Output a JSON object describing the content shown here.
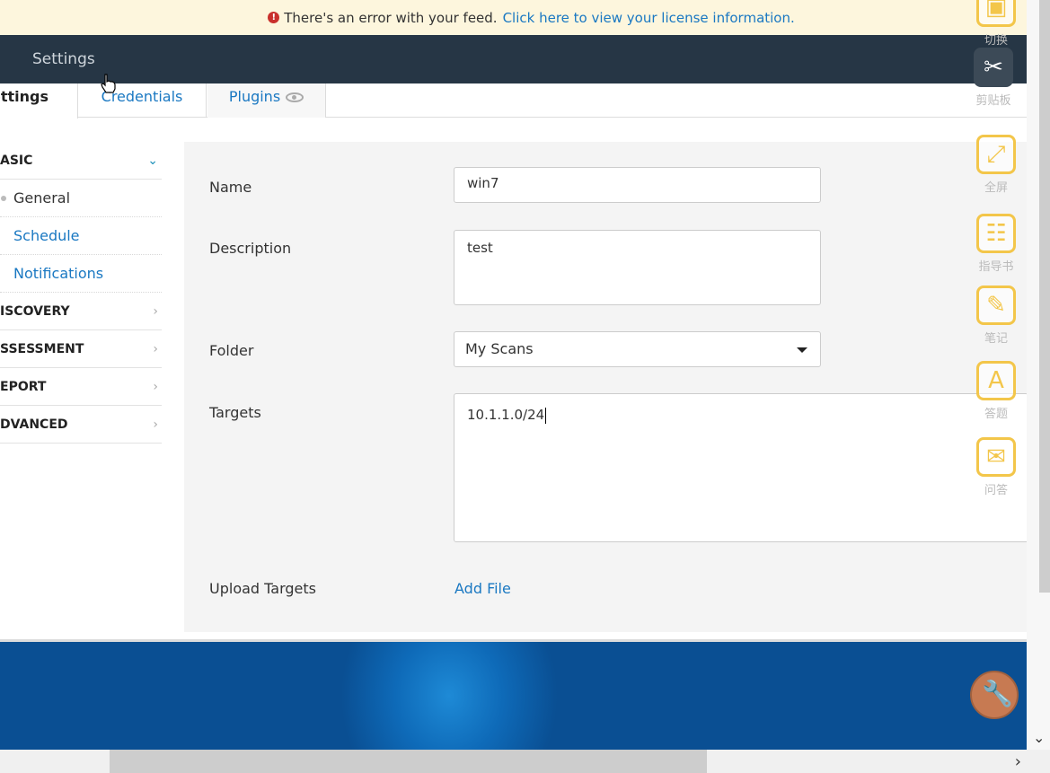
{
  "banner": {
    "message": "There's an error with your feed.",
    "link_text": "Click here to view your license information.",
    "icon": "error-icon"
  },
  "topnav": {
    "item": "Settings"
  },
  "tabs": [
    {
      "label": "ettings",
      "active": true
    },
    {
      "label": "Credentials"
    },
    {
      "label": "Plugins",
      "icon": "eye-icon"
    }
  ],
  "sidebar": {
    "sections": [
      {
        "label": "ASIC",
        "open": true,
        "items": [
          {
            "label": "General",
            "active": true
          },
          {
            "label": "Schedule"
          },
          {
            "label": "Notifications"
          }
        ]
      },
      {
        "label": "ISCOVERY"
      },
      {
        "label": "SSESSMENT"
      },
      {
        "label": "EPORT"
      },
      {
        "label": "DVANCED"
      }
    ]
  },
  "form": {
    "name_label": "Name",
    "name_value": "win7",
    "description_label": "Description",
    "description_value": "test",
    "folder_label": "Folder",
    "folder_value": "My Scans",
    "targets_label": "Targets",
    "targets_value": "10.1.1.0/24",
    "upload_label": "Upload Targets",
    "add_file": "Add File"
  },
  "right_toolbar": [
    {
      "label": "切换",
      "icon": "switch-icon"
    },
    {
      "label": "剪贴板",
      "icon": "scissors-icon",
      "active": true
    },
    {
      "label": "全屏",
      "icon": "fullscreen-icon"
    },
    {
      "label": "指导书",
      "icon": "book-icon"
    },
    {
      "label": "笔记",
      "icon": "pen-icon"
    },
    {
      "label": "答题",
      "icon": "answer-icon"
    },
    {
      "label": "问答",
      "icon": "qa-icon"
    }
  ],
  "colors": {
    "accent": "#1a78c2",
    "nav": "#263645",
    "banner_bg": "#fdf6dd",
    "error": "#c9302c"
  }
}
